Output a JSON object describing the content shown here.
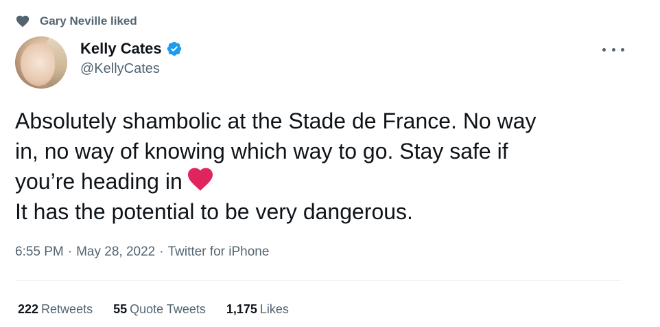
{
  "social_context": {
    "text": "Gary Neville liked",
    "icon": "heart-icon"
  },
  "author": {
    "name": "Kelly Cates",
    "handle": "@KellyCates",
    "verified": true
  },
  "tweet": {
    "line1": "Absolutely shambolic at the Stade de France. No way",
    "line2": "in, no way of knowing which way to go. Stay safe if",
    "line3": "you’re heading in",
    "line4": "It has the potential to be very dangerous.",
    "emoji": "red-heart"
  },
  "meta": {
    "time": "6:55 PM",
    "separator": "·",
    "date": "May 28, 2022",
    "source": "Twitter for iPhone"
  },
  "stats": {
    "retweets_count": "222",
    "retweets_label": "Retweets",
    "quotes_count": "55",
    "quotes_label": "Quote Tweets",
    "likes_count": "1,175",
    "likes_label": "Likes"
  },
  "colors": {
    "text_primary": "#0f1419",
    "text_secondary": "#536471",
    "verified_blue": "#1d9bf0",
    "heart_red": "#e0245e",
    "divider": "#eff3f4"
  }
}
